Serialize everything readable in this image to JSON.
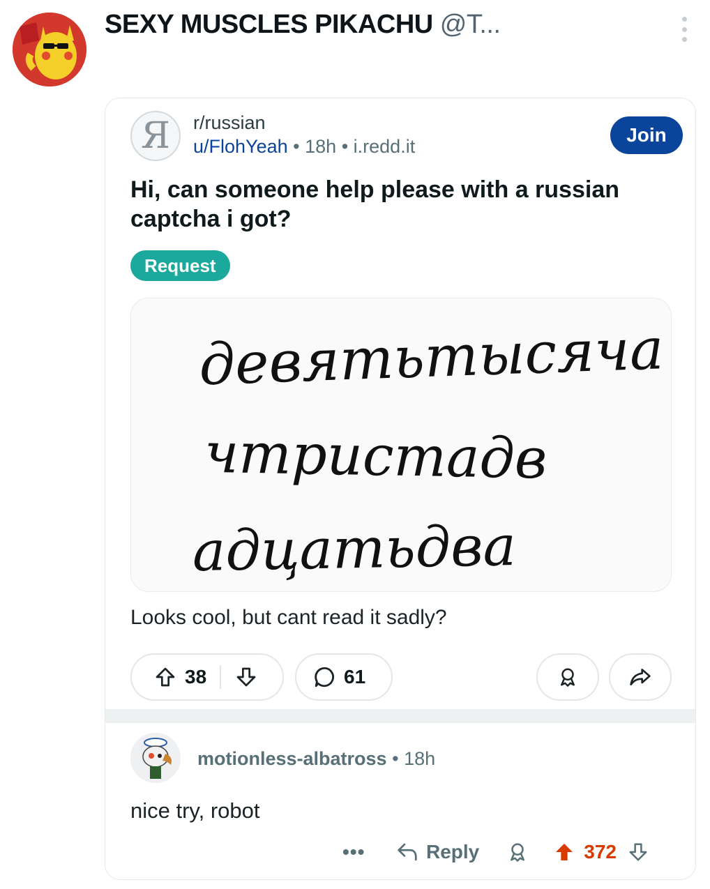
{
  "tweet": {
    "display_name": "SEXY MUSCLES PIKACHU",
    "handle": "@T...",
    "avatar_icon": "pikachu-avatar-icon"
  },
  "post": {
    "subreddit": "r/russian",
    "author": "u/FlohYeah",
    "sep1": "•",
    "age": "18h",
    "sep2": "•",
    "domain": "i.redd.it",
    "join_label": "Join",
    "title": "Hi, can someone help please with a russian captcha i got?",
    "flair": "Request",
    "captcha_lines": [
      "девятьтысяча",
      "чтристадв",
      "адцатьдва"
    ],
    "body": "Looks cool, but cant read it sadly?",
    "upvotes": "38",
    "comments": "61"
  },
  "comment": {
    "author": "motionless-albatross",
    "sep": "•",
    "age": "18h",
    "body": "nice try, robot",
    "more_label": "•••",
    "reply_label": "Reply",
    "score": "372"
  },
  "colors": {
    "join_bg": "#0a449b",
    "flair_bg": "#1ba89d",
    "upvote_active": "#d93a00"
  }
}
